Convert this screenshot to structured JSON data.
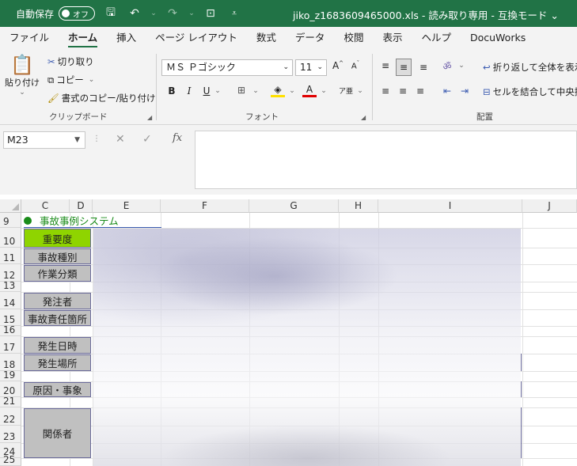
{
  "titlebar": {
    "autosave_label": "自動保存",
    "autosave_state": "オフ",
    "document_title": "jiko_z1683609465000.xls  -  読み取り専用  -  互換モード ⌄"
  },
  "tabs": [
    {
      "label": "ファイル",
      "active": false
    },
    {
      "label": "ホーム",
      "active": true
    },
    {
      "label": "挿入",
      "active": false
    },
    {
      "label": "ページ レイアウト",
      "active": false
    },
    {
      "label": "数式",
      "active": false
    },
    {
      "label": "データ",
      "active": false
    },
    {
      "label": "校閲",
      "active": false
    },
    {
      "label": "表示",
      "active": false
    },
    {
      "label": "ヘルプ",
      "active": false
    },
    {
      "label": "DocuWorks",
      "active": false
    }
  ],
  "clipboard": {
    "paste": "貼り付け",
    "cut": "切り取り",
    "copy": "コピー",
    "format_painter": "書式のコピー/貼り付け",
    "group": "クリップボード"
  },
  "font": {
    "name": "ＭＳ Ｐゴシック",
    "size": "11",
    "bold": "B",
    "italic": "I",
    "underline": "U",
    "group": "フォント"
  },
  "alignment": {
    "wrap": "折り返して全体を表示",
    "merge": "セルを結合して中央揃",
    "group": "配置"
  },
  "formula_bar": {
    "name_box": "M23",
    "fx": "fx",
    "value": ""
  },
  "columns": [
    "C",
    "D",
    "E",
    "F",
    "G",
    "H",
    "I",
    "J"
  ],
  "rows": [
    "9",
    "10",
    "11",
    "12",
    "13",
    "14",
    "15",
    "16",
    "17",
    "18",
    "19",
    "20",
    "21",
    "22",
    "23",
    "24",
    "25"
  ],
  "sheet": {
    "title": "事故事例システム",
    "labels": {
      "severity": "重要度",
      "accident_type": "事故種別",
      "work_category": "作業分類",
      "client": "発注者",
      "responsible_location": "事故責任箇所",
      "datetime": "発生日時",
      "location": "発生場所",
      "cause": "原因・事象",
      "persons": "関係者"
    }
  },
  "colors": {
    "excel_green": "#217346",
    "severity_fill": "#8fd400",
    "label_fill": "#c0c0c0",
    "title_text": "#1a8c1a"
  }
}
